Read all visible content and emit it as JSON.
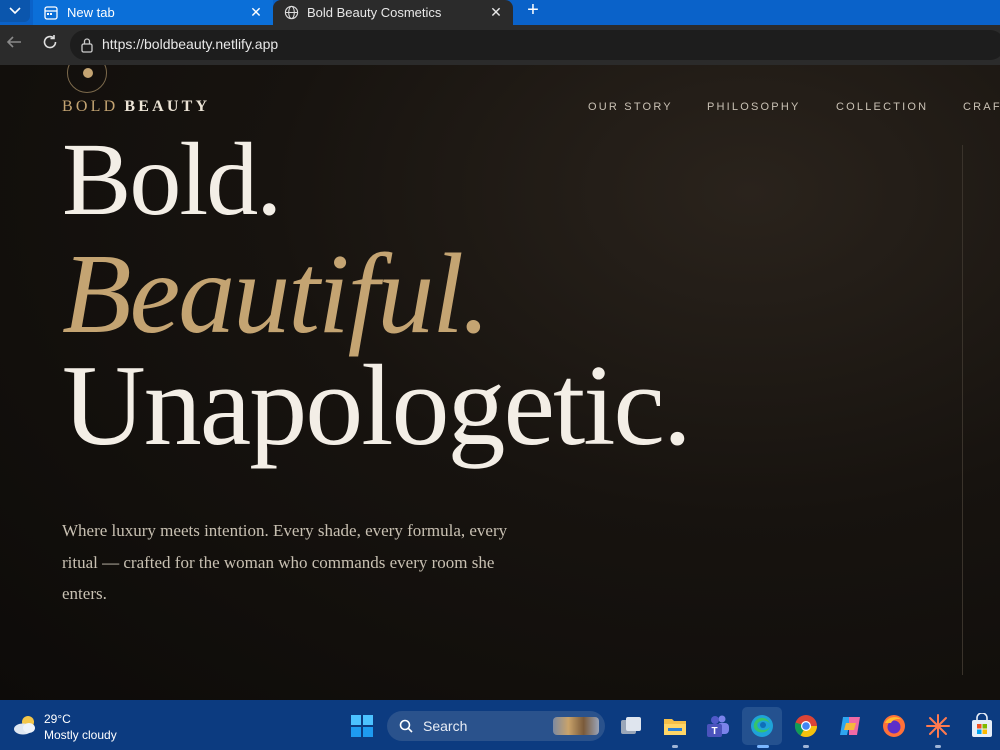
{
  "browser": {
    "tabs": [
      {
        "label": "New tab",
        "icon": "new-tab-icon"
      },
      {
        "label": "Bold Beauty Cosmetics",
        "icon": "globe-icon",
        "active": true
      }
    ],
    "url": "https://boldbeauty.netlify.app"
  },
  "site": {
    "brand_first": "BOLD",
    "brand_second": "BEAUTY",
    "nav": [
      "OUR STORY",
      "PHILOSOPHY",
      "COLLECTION",
      "CRAFT"
    ],
    "hero": {
      "line1": "Bold.",
      "line2": "Beautiful.",
      "line3": "Unapologetic.",
      "lead": "Where luxury meets intention. Every shade, every formula, every ritual — crafted for the woman who commands every room she enters."
    },
    "colors": {
      "gold": "#c4a472",
      "cream": "#f3eee6",
      "background": "#0e0c0a"
    }
  },
  "taskbar": {
    "weather_temp": "29°C",
    "weather_condition": "Mostly cloudy",
    "search_placeholder": "Search",
    "apps": [
      "task-view-icon",
      "file-explorer-icon",
      "teams-icon",
      "edge-icon",
      "chrome-icon",
      "copilot-icon",
      "firefox-icon",
      "spark-app-icon",
      "store-icon"
    ]
  }
}
